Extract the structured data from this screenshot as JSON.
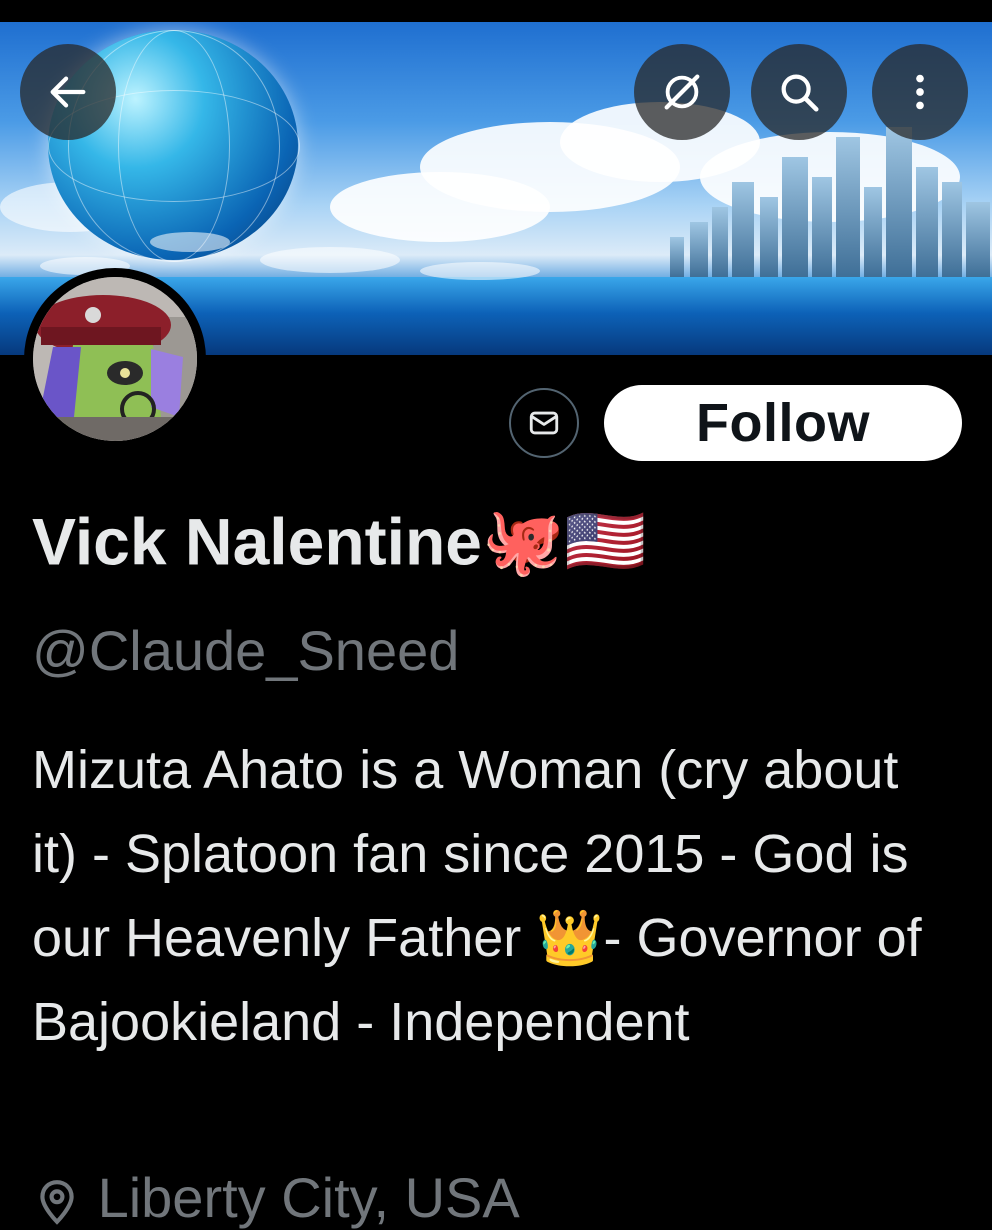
{
  "header": {
    "back_icon": "arrow-left-icon",
    "grok_icon": "grok-icon",
    "search_icon": "search-icon",
    "more_icon": "more-vertical-icon"
  },
  "profile": {
    "display_name": "Vick Nalentine",
    "name_emojis": "🐙🇺🇸",
    "handle": "@Claude_Sneed",
    "bio": "Mizuta Ahato is a Woman (cry about it) -  Splatoon fan since 2015 -  God is our Heavenly Father 👑-  Governor of Bajookieland -  Independent",
    "location": "Liberty City, USA"
  },
  "actions": {
    "message_icon": "mail-icon",
    "follow_label": "Follow"
  },
  "colors": {
    "background": "#000000",
    "primary_text": "#e7e9ea",
    "secondary_text": "#71767b",
    "follow_bg": "#ffffff"
  }
}
